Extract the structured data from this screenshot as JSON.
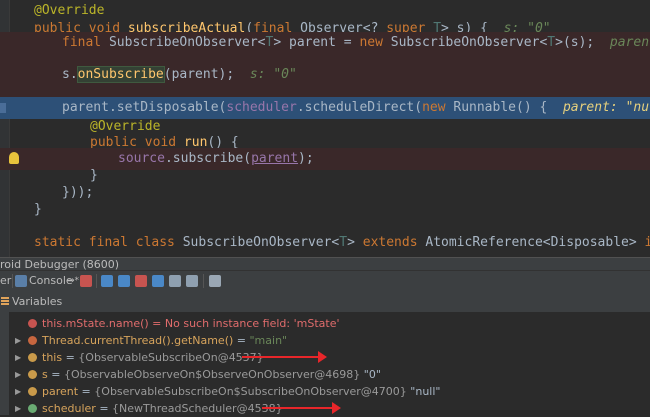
{
  "editor": {
    "lines": {
      "l1": {
        "ann": "@Override"
      },
      "l2": {
        "kw1": "public void ",
        "fn": "subscribeActual",
        "p1": "(",
        "kw2": "final ",
        "p2": "Observer<? ",
        "kw3": "super ",
        "tp": "T",
        "p3": "> s) {",
        "hint": "s: \"0\""
      },
      "l3": {
        "kw1": "final ",
        "p1": "SubscribeOnObserver<",
        "tp1": "T",
        "p2": "> parent = ",
        "kw2": "new ",
        "p3": "SubscribeOnObserver<",
        "tp2": "T",
        "p4": ">(s);",
        "hint": "parent: \"null\""
      },
      "l4": {
        "p1": "s.",
        "fn": "onSubscribe",
        "p2": "(parent);",
        "hint": "s: \"0\""
      },
      "l5": {
        "p1": "parent.setDisposable(",
        "fld": "scheduler",
        "p2": ".scheduleDirect(",
        "kw": "new ",
        "p3": "Runnable() {",
        "hint": "parent: \"null\""
      },
      "l6": {
        "ann": "@Override"
      },
      "l7": {
        "kw": "public void ",
        "fn": "run",
        "p1": "() {"
      },
      "l8": {
        "fld": "source",
        "p1": ".subscribe(",
        "und": "parent",
        "p2": ");"
      },
      "l9": {
        "p1": "}"
      },
      "l10": {
        "p1": "}));"
      },
      "l11": {
        "p1": "}"
      },
      "l12": {
        "kw1": "static final class ",
        "p1": "SubscribeOnObserver<",
        "tp": "T",
        "p2": "> ",
        "kw2": "extends ",
        "p3": "AtomicReference<Disposable> ",
        "kw3": "implements"
      }
    }
  },
  "debugger": {
    "title": "roid Debugger (8600)",
    "tabs": {
      "debugger": "er",
      "console": "Console",
      "console_suffix": "→*"
    },
    "variables_label": "Variables"
  },
  "variables": [
    {
      "name": "this.mState.name()",
      "value": " = No such instance field: 'mState'"
    },
    {
      "name": "Thread.currentThread().getName()",
      "value": " = ",
      "str": "\"main\""
    },
    {
      "name": "this",
      "value": " = ",
      "gray": "{ObservableSubscribeOn@4537}"
    },
    {
      "name": "s",
      "value": " = ",
      "gray": "{ObservableObserveOn$ObserveOnObserver@4698}",
      "tail": " \"0\""
    },
    {
      "name": "parent",
      "value": " = ",
      "gray": "{ObservableSubscribeOn$SubscribeOnObserver@4700}",
      "tail": " \"null\""
    },
    {
      "name": "scheduler",
      "value": " = ",
      "gray": "{NewThreadScheduler@4538}"
    }
  ],
  "colors": {
    "annotation_arrow": "#e8262a",
    "current_line": "#2d5077"
  }
}
